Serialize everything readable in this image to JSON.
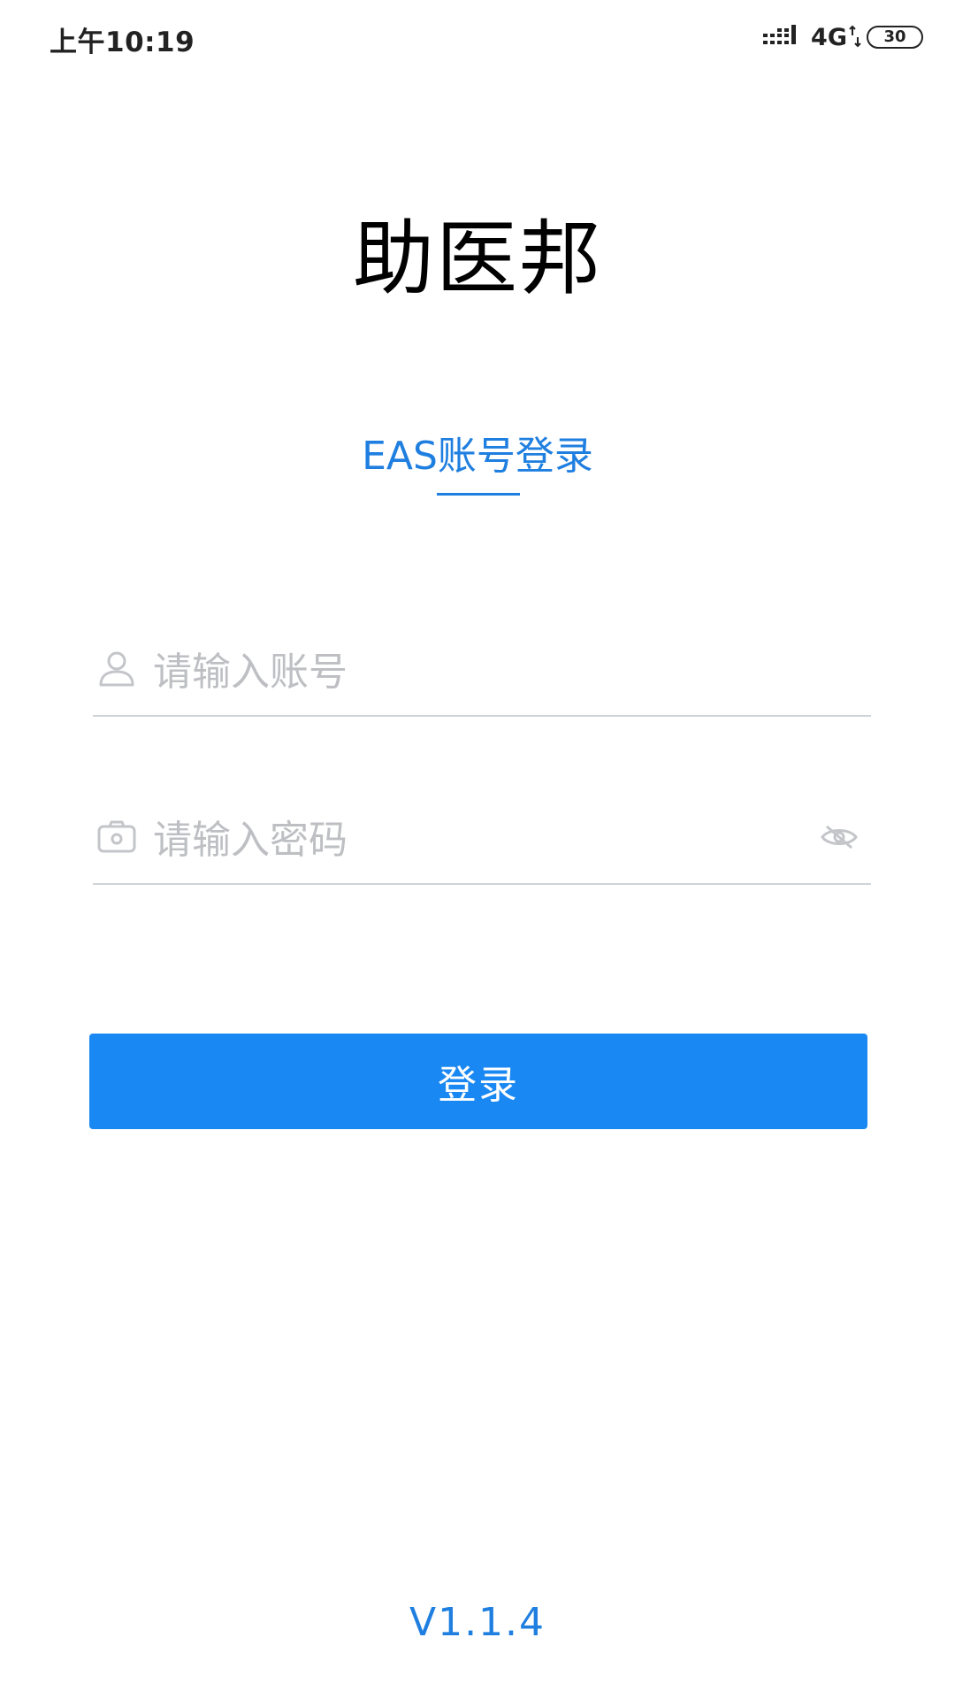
{
  "status_bar": {
    "time": "上午10:19",
    "network": "4G",
    "battery_level": "30",
    "icons": [
      "signal-icon",
      "data-arrows-icon",
      "battery-icon"
    ]
  },
  "app": {
    "title": "助医邦"
  },
  "login_tab": {
    "label": "EAS账号登录"
  },
  "account_field": {
    "placeholder": "请输入账号",
    "value": "",
    "icon": "user-icon"
  },
  "password_field": {
    "placeholder": "请输入密码",
    "value": "",
    "icon": "lock-icon",
    "toggle_icon": "eye-icon"
  },
  "login_button": {
    "label": "登录"
  },
  "version": "V1.1.4",
  "colors": {
    "accent": "#1f7fe0",
    "button": "#1a88f2",
    "placeholder": "#bdbfc3",
    "divider": "#cfd3d8"
  }
}
